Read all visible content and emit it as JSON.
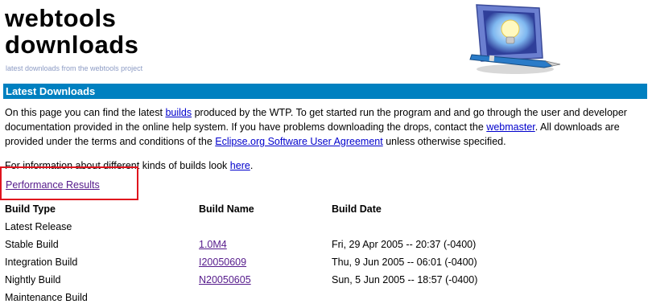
{
  "header": {
    "title_line1": "webtools",
    "title_line2": "downloads",
    "subtitle": "latest downloads from the webtools project"
  },
  "section": {
    "title": "Latest Downloads"
  },
  "intro": {
    "t1": "On this page you can find the latest ",
    "link_builds": "builds",
    "t2": " produced by the WTP. To get started run the program and and go through the user and developer documentation provided in the online help system. If you have problems downloading the drops, contact the ",
    "link_webmaster": "webmaster",
    "t3": ". All downloads are provided under the terms and conditions of the ",
    "link_agreement": "Eclipse.org Software User Agreement",
    "t4": " unless otherwise specified."
  },
  "info": {
    "text": "For information about different kinds of builds look ",
    "link_here": "here",
    "end": "."
  },
  "perf_link": "Performance Results",
  "table": {
    "headers": {
      "type": "Build Type",
      "name": "Build Name",
      "date": "Build Date"
    },
    "rows": [
      {
        "type": "Latest Release",
        "name": "",
        "date": ""
      },
      {
        "type": "Stable Build",
        "name": "1.0M4",
        "date": "Fri, 29 Apr 2005 -- 20:37 (-0400)"
      },
      {
        "type": "Integration Build",
        "name": "I20050609",
        "date": "Thu, 9 Jun 2005 -- 06:01 (-0400)"
      },
      {
        "type": "Nightly Build",
        "name": "N20050605",
        "date": "Sun, 5 Jun 2005 -- 18:57 (-0400)"
      },
      {
        "type": "Maintenance Build",
        "name": "",
        "date": ""
      }
    ]
  },
  "colors": {
    "bar": "#0080c0",
    "link": "#0000cc",
    "visited": "#551a8b",
    "highlight": "#e0141e"
  }
}
